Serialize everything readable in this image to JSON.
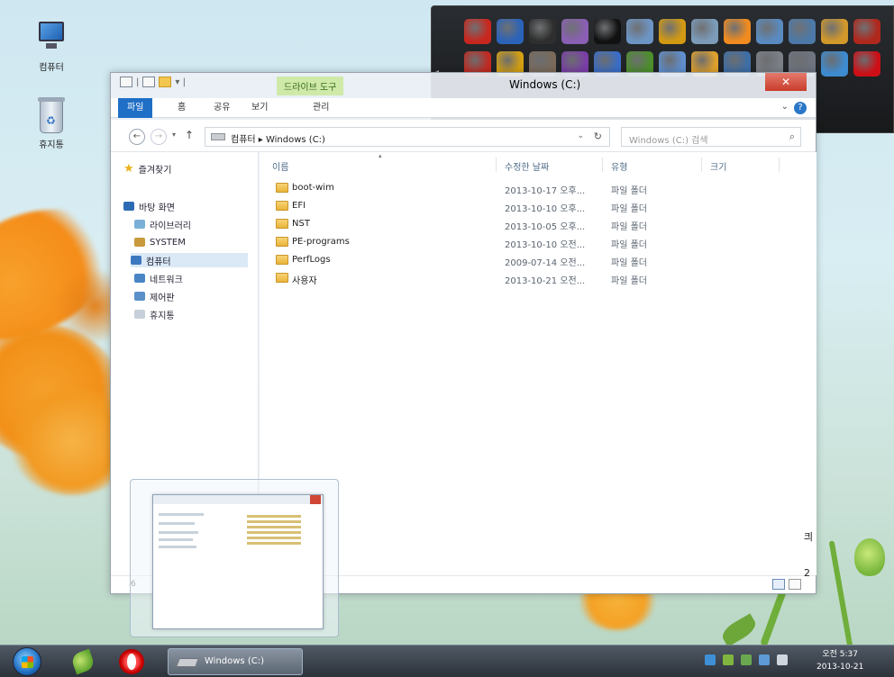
{
  "desktop": {
    "icons": [
      {
        "label": "컴퓨터"
      },
      {
        "label": "휴지통"
      }
    ]
  },
  "window": {
    "title": "Windows (C:)",
    "context_tab": "드라이브 도구",
    "close_glyph": "✕",
    "ribbon": {
      "tabs": [
        "파일",
        "홈",
        "공유",
        "보기",
        "관리"
      ]
    },
    "address": {
      "path": "컴퓨터 ▸ Windows (C:)",
      "search_placeholder": "Windows (C:) 검색"
    },
    "nav": {
      "favorites": "즐겨찾기",
      "desktop": "바탕 화면",
      "items": [
        "라이브러리",
        "SYSTEM",
        "컴퓨터",
        "네트워크",
        "제어판",
        "휴지통"
      ]
    },
    "columns": {
      "name": "이름",
      "date": "수정한 날짜",
      "type": "유형",
      "size": "크기"
    },
    "files": [
      {
        "name": "boot-wim",
        "date": "2013-10-17 오후...",
        "type": "파일 폴더"
      },
      {
        "name": "EFI",
        "date": "2013-10-10 오후...",
        "type": "파일 폴더"
      },
      {
        "name": "NST",
        "date": "2013-10-05 오후...",
        "type": "파일 폴더"
      },
      {
        "name": "PE-programs",
        "date": "2013-10-10 오전...",
        "type": "파일 폴더"
      },
      {
        "name": "PerfLogs",
        "date": "2009-07-14 오전...",
        "type": "파일 폴더"
      },
      {
        "name": "사용자",
        "date": "2013-10-21 오전...",
        "type": "파일 폴더"
      }
    ],
    "status_left": "6",
    "edge_glyphs": [
      "킈",
      "2"
    ]
  },
  "gadget": {
    "icons": [
      {
        "name": "app-red-square-icon",
        "color": "#c8271f"
      },
      {
        "name": "app-blue-arrow-icon",
        "color": "#2b63b9"
      },
      {
        "name": "app-7zip-icon",
        "color": "#2e2e2e"
      },
      {
        "name": "app-disc-icon",
        "color": "#8a5fb3"
      },
      {
        "name": "app-console-icon",
        "color": "#111111"
      },
      {
        "name": "app-calculator-icon",
        "color": "#6d95c4"
      },
      {
        "name": "app-sun-icon",
        "color": "#d29a13"
      },
      {
        "name": "app-brush-icon",
        "color": "#7b9bb9"
      },
      {
        "name": "app-orange-disc-icon",
        "color": "#f18b1f"
      },
      {
        "name": "app-window-icon",
        "color": "#5a8bc0"
      },
      {
        "name": "app-hdd-icon",
        "color": "#4d79a8"
      },
      {
        "name": "app-search-icon",
        "color": "#d1982a"
      },
      {
        "name": "app-nt-red-icon",
        "color": "#b0271c"
      },
      {
        "name": "app-nt-pin-icon",
        "color": "#c02a22"
      },
      {
        "name": "app-wand-icon",
        "color": "#d4a012"
      },
      {
        "name": "app-eraser-icon",
        "color": "#7a6a5a"
      },
      {
        "name": "app-purple-window-icon",
        "color": "#7a3ea7"
      },
      {
        "name": "app-pie-icon",
        "color": "#3a6dc7"
      },
      {
        "name": "app-globe-icon",
        "color": "#4c8f2b"
      },
      {
        "name": "app-paint-icon",
        "color": "#5f8fd0"
      },
      {
        "name": "app-r-icon",
        "color": "#e0a12c"
      },
      {
        "name": "app-tools-icon",
        "color": "#3d6ea6"
      },
      {
        "name": "app-diamond-icon",
        "color": "#7b7f87"
      },
      {
        "name": "app-diamond2-icon",
        "color": "#6e7480"
      },
      {
        "name": "app-book-icon",
        "color": "#3d8bd0"
      },
      {
        "name": "app-opera-icon",
        "color": "#cc0f16"
      }
    ]
  },
  "taskbar": {
    "task_label": "Windows (C:)",
    "clock_time": "오전 5:37",
    "clock_date": "2013-10-21"
  }
}
